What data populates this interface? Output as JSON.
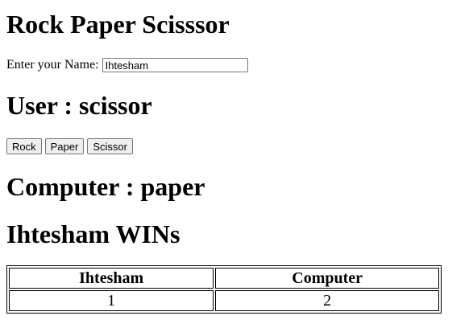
{
  "title": "Rock Paper Scisssor",
  "name_label": "Enter your Name:",
  "name_value": "Ihtesham",
  "user_choice_text": "User : scissor",
  "buttons": {
    "rock": "Rock",
    "paper": "Paper",
    "scissor": "Scissor"
  },
  "computer_choice_text": "Computer : paper",
  "result_text": "Ihtesham WINs",
  "scoreboard": {
    "headers": [
      "Ihtesham",
      "Computer"
    ],
    "scores": [
      "1",
      "2"
    ]
  }
}
